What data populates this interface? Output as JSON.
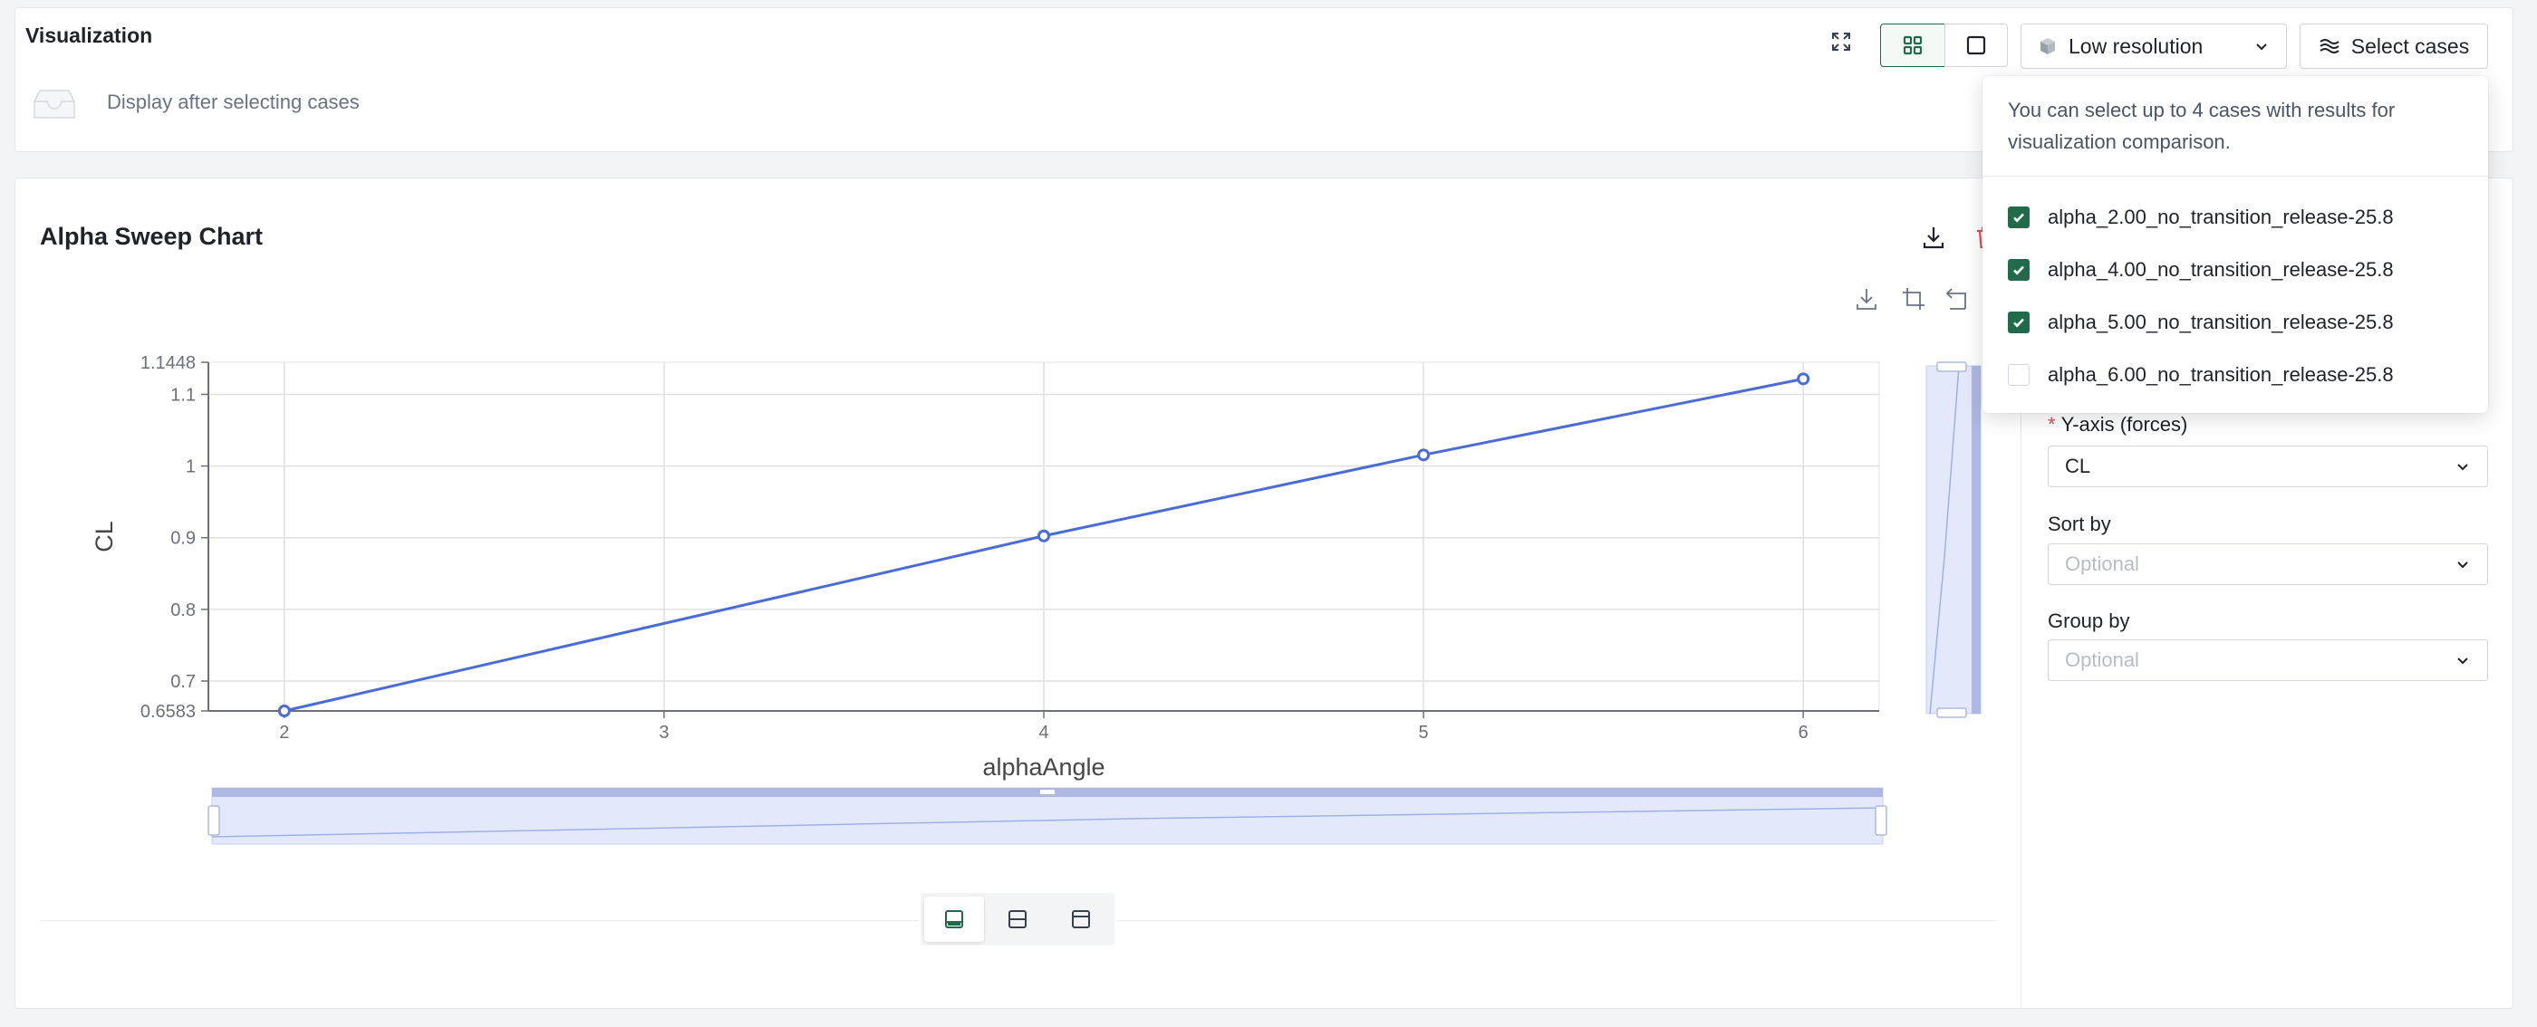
{
  "header": {
    "title": "Visualization",
    "empty_text": "Display after selecting cases",
    "resolution_label": "Low resolution",
    "select_cases_label": "Select cases"
  },
  "dropdown": {
    "note": "You can select up to 4 cases with results for visualization comparison.",
    "items": [
      {
        "label": "alpha_2.00_no_transition_release-25.8",
        "checked": true
      },
      {
        "label": "alpha_4.00_no_transition_release-25.8",
        "checked": true
      },
      {
        "label": "alpha_5.00_no_transition_release-25.8",
        "checked": true
      },
      {
        "label": "alpha_6.00_no_transition_release-25.8",
        "checked": false
      }
    ]
  },
  "chart_panel": {
    "title": "Alpha Sweep Chart"
  },
  "form": {
    "y_axis_label": "Y-axis (forces)",
    "y_axis_value": "CL",
    "sort_label": "Sort by",
    "sort_placeholder": "Optional",
    "group_label": "Group by",
    "group_placeholder": "Optional"
  },
  "colors": {
    "accent": "#1f6b4a",
    "series": "#4a6bd8",
    "danger": "#e34d59"
  },
  "chart_data": {
    "type": "line",
    "xlabel": "alphaAngle",
    "ylabel": "CL",
    "x": [
      2,
      4,
      5,
      6
    ],
    "series": [
      {
        "values": [
          0.6583,
          0.9025,
          1.0155,
          1.1216
        ]
      }
    ],
    "xlim": [
      1.8,
      6.2
    ],
    "ylim": [
      0.6583,
      1.1448
    ],
    "xticks": [
      "2",
      "3",
      "4",
      "5",
      "6"
    ],
    "yticks": [
      "0.6583",
      "0.7",
      "0.8",
      "0.9",
      "1",
      "1.1",
      "1.1448"
    ],
    "grid": true,
    "dataZoom": true
  }
}
